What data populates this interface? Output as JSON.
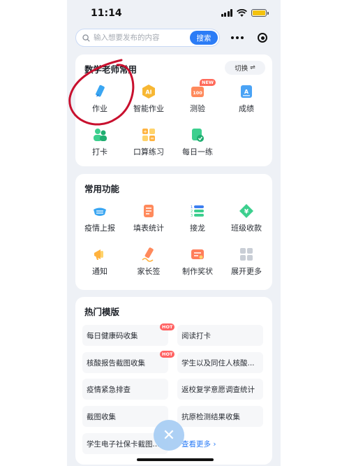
{
  "status_bar": {
    "time": "11:14"
  },
  "search": {
    "placeholder": "输入想要发布的内容",
    "button": "搜索"
  },
  "teacher_section": {
    "title": "数学老师常用",
    "switch_label": "切换",
    "items": [
      {
        "label": "作业",
        "icon": "pencil-icon"
      },
      {
        "label": "智能作业",
        "icon": "ai-badge-icon"
      },
      {
        "label": "测验",
        "icon": "score-100-icon",
        "badge": "NEW"
      },
      {
        "label": "成绩",
        "icon": "grade-icon"
      },
      {
        "label": "打卡",
        "icon": "checkin-people-icon"
      },
      {
        "label": "口算练习",
        "icon": "math-symbols-icon"
      },
      {
        "label": "每日一练",
        "icon": "daily-practice-icon"
      }
    ]
  },
  "common_section": {
    "title": "常用功能",
    "items": [
      {
        "label": "疫情上报",
        "icon": "mask-icon"
      },
      {
        "label": "填表统计",
        "icon": "form-icon"
      },
      {
        "label": "接龙",
        "icon": "list-chain-icon"
      },
      {
        "label": "班级收款",
        "icon": "yuan-payment-icon"
      },
      {
        "label": "通知",
        "icon": "megaphone-icon"
      },
      {
        "label": "家长签",
        "icon": "signature-icon"
      },
      {
        "label": "制作奖状",
        "icon": "certificate-icon"
      },
      {
        "label": "展开更多",
        "icon": "grid-more-icon"
      }
    ]
  },
  "templates_section": {
    "title": "热门模版",
    "items": [
      {
        "label": "每日健康码收集",
        "badge": "HOT"
      },
      {
        "label": "阅读打卡"
      },
      {
        "label": "核酸报告截图收集",
        "badge": "HOT"
      },
      {
        "label": "学生以及同住人核酸..."
      },
      {
        "label": "疫情紧急排查"
      },
      {
        "label": "返校复学意愿调查统计"
      },
      {
        "label": "截图收集"
      },
      {
        "label": "抗原检测结果收集"
      },
      {
        "label": "学生电子社保卡截图..."
      },
      {
        "label": "查看更多 ›"
      }
    ]
  },
  "fab": {
    "icon": "close-icon",
    "symbol": "✕"
  },
  "colors": {
    "accent": "#2b7cf6",
    "annotation": "#c8102e"
  }
}
